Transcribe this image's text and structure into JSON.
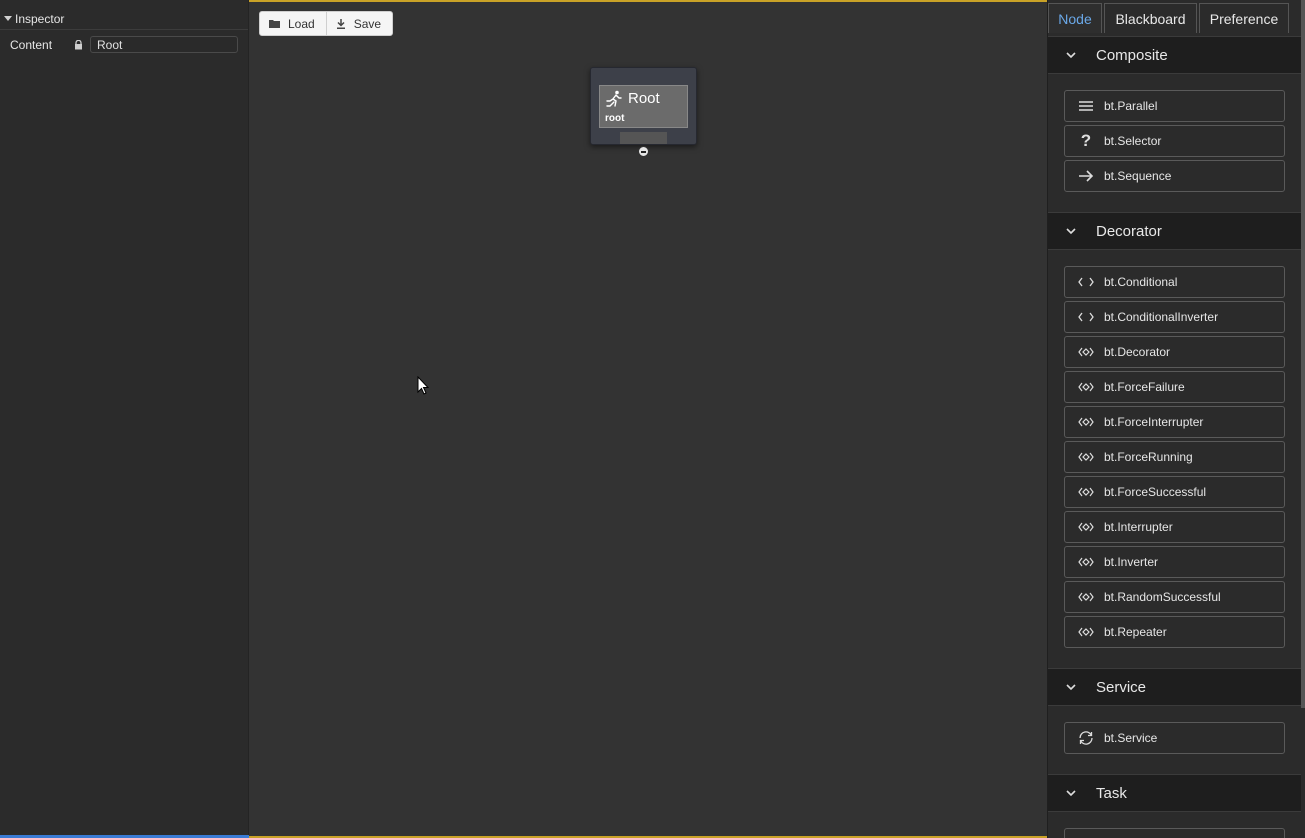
{
  "inspector": {
    "title": "Inspector",
    "content_label": "Content",
    "content_value": "Root"
  },
  "toolbar": {
    "load_label": "Load",
    "save_label": "Save"
  },
  "root_node": {
    "name": "Root",
    "type": "root"
  },
  "tabs": {
    "node": "Node",
    "blackboard": "Blackboard",
    "preference": "Preference"
  },
  "sections": {
    "composite": {
      "title": "Composite",
      "items": [
        "bt.Parallel",
        "bt.Selector",
        "bt.Sequence"
      ]
    },
    "decorator": {
      "title": "Decorator",
      "items": [
        "bt.Conditional",
        "bt.ConditionalInverter",
        "bt.Decorator",
        "bt.ForceFailure",
        "bt.ForceInterrupter",
        "bt.ForceRunning",
        "bt.ForceSuccessful",
        "bt.Interrupter",
        "bt.Inverter",
        "bt.RandomSuccessful",
        "bt.Repeater"
      ]
    },
    "service": {
      "title": "Service",
      "items": [
        "bt.Service"
      ]
    },
    "task": {
      "title": "Task"
    }
  },
  "colors": {
    "canvas_bg": "#333333",
    "panel_bg": "#2b2b2b",
    "active_tab": "#6aa8e8",
    "canvas_border": "#c9a227"
  }
}
